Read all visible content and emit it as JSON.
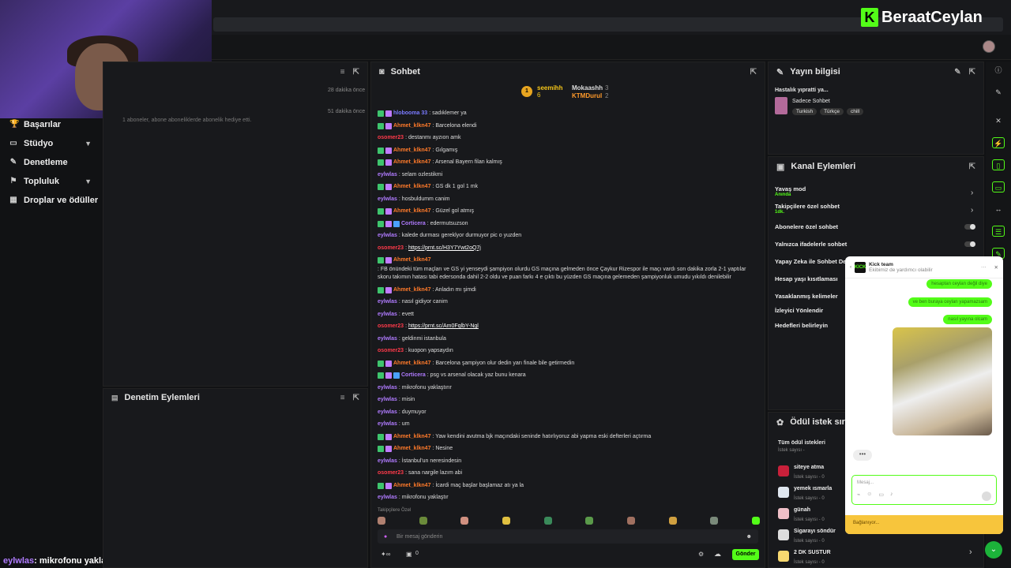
{
  "brand": {
    "logo_letter": "K",
    "name": "BeraatCeylan",
    "accent": "#53fc18"
  },
  "nav": {
    "items": [
      {
        "label": "Başarılar",
        "icon": "trophy-icon",
        "chev": ""
      },
      {
        "label": "Stüdyo",
        "icon": "monitor-icon",
        "chev": "⌄"
      },
      {
        "label": "Denetleme",
        "icon": "wrench-icon",
        "chev": ""
      },
      {
        "label": "Topluluk",
        "icon": "community-icon",
        "chev": "⌄"
      },
      {
        "label": "Droplar ve ödüller",
        "icon": "gift-icon",
        "chev": ""
      }
    ]
  },
  "caption": {
    "user": "eylwlas",
    "text": ": mikrofonu yaklaştır"
  },
  "notifications": {
    "rows": [
      {
        "time": "28 dakika önce"
      },
      {
        "time": "51 dakika önce",
        "text": "1 aboneler, abone aboneliklerde abonelik hediye etti."
      }
    ]
  },
  "moderation": {
    "title": "Denetim Eylemleri"
  },
  "chat": {
    "title": "Sohbet",
    "leaders": [
      {
        "name": "seemihh",
        "count": "6"
      },
      {
        "name": "Mokaashh",
        "count": "3"
      },
      {
        "name": "KTMDurul",
        "count": "2"
      }
    ],
    "messages": [
      {
        "user": "hlobooma 33",
        "color": "#7a7aff",
        "text": ": sadıklemer ya",
        "badges": 2
      },
      {
        "user": "Ahmet_klkn47",
        "color": "#ff7a2a",
        "text": ": Barcelona elendi",
        "badges": 2
      },
      {
        "user": "osomer23",
        "color": "#ff3a4a",
        "text": ": destanmı ayzıon amk",
        "badges": 0
      },
      {
        "user": "Ahmet_klkn47",
        "color": "#ff7a2a",
        "text": ": Gılgamış",
        "badges": 2
      },
      {
        "user": "Ahmet_klkn47",
        "color": "#ff7a2a",
        "text": ": Arsenal Bayern filan kalmış",
        "badges": 2
      },
      {
        "user": "eylwlas",
        "color": "#b07bff",
        "text": ": selam ozlestikmi",
        "badges": 0
      },
      {
        "user": "Ahmet_klkn47",
        "color": "#ff7a2a",
        "text": ": GS dk 1 gol 1 mk",
        "badges": 2
      },
      {
        "user": "eylwlas",
        "color": "#b07bff",
        "text": ": hosbuldumm canim",
        "badges": 0
      },
      {
        "user": "Ahmet_klkn47",
        "color": "#ff7a2a",
        "text": ": Güzel gol atmış",
        "badges": 2
      },
      {
        "user": "Corticera",
        "color": "#b07bff",
        "text": ": edermutsuzson",
        "badges": 3
      },
      {
        "user": "eylwlas",
        "color": "#b07bff",
        "text": ": kalede durması gereklyor durmuyor pic o yuzden",
        "badges": 0
      },
      {
        "user": "osomer23",
        "color": "#ff3a4a",
        "text": ": ",
        "link": "https://prnt.sc/H3Y7Ywt2oQ7j",
        "badges": 0
      },
      {
        "user": "Ahmet_klkn47",
        "color": "#ff7a2a",
        "text": ": FB önündeki tüm maçları ve GS yi yenseydi şampiyon olurdu GS maçına gelmeden önce Çaykur Rizespor ile maçı vardı son dakika zorla 2-1 yaptılar skoru takımın hatası tabi edersonda dahil 2-2 oldu ve puan farkı 4 e çıktı bu yüzden GS maçına gelemeden şampiyonluk umudu yıkıldı denilebilir",
        "badges": 2
      },
      {
        "user": "Ahmet_klkn47",
        "color": "#ff7a2a",
        "text": ": Anladın mı şimdi",
        "badges": 2
      },
      {
        "user": "eylwlas",
        "color": "#b07bff",
        "text": ": nasıl gidiyor canim",
        "badges": 0
      },
      {
        "user": "eylwlas",
        "color": "#b07bff",
        "text": ": evett",
        "badges": 0
      },
      {
        "user": "osomer23",
        "color": "#ff3a4a",
        "text": ": ",
        "link": "https://prnt.sc/Am0FqlbY-Ngl",
        "badges": 0
      },
      {
        "user": "eylwlas",
        "color": "#b07bff",
        "text": ": geldinmi istanbula",
        "badges": 0
      },
      {
        "user": "osomer23",
        "color": "#ff3a4a",
        "text": ": kuopon yapsaydın",
        "badges": 0
      },
      {
        "user": "Ahmet_klkn47",
        "color": "#ff7a2a",
        "text": ": Barcelona şampiyon olur dedin yarı finale bile getirmedin",
        "badges": 2
      },
      {
        "user": "Corticera",
        "color": "#b07bff",
        "text": ": psg vs arsenal olacak yaz bunu kenara",
        "badges": 3
      },
      {
        "user": "eylwlas",
        "color": "#b07bff",
        "text": ": mikrofonu yaklaştırır",
        "badges": 0
      },
      {
        "user": "eylwlas",
        "color": "#b07bff",
        "text": ": misin",
        "badges": 0
      },
      {
        "user": "eylwlas",
        "color": "#b07bff",
        "text": ": duymuyor",
        "badges": 0
      },
      {
        "user": "eylwlas",
        "color": "#b07bff",
        "text": ": um",
        "badges": 0
      },
      {
        "user": "Ahmet_klkn47",
        "color": "#ff7a2a",
        "text": ": Yaw kendini avutma bjk maçındaki seninde hatırlıyoruz abi yapma eski defterleri açtırma",
        "badges": 2
      },
      {
        "user": "Ahmet_klkn47",
        "color": "#ff7a2a",
        "text": ": Nesine",
        "badges": 2
      },
      {
        "user": "eylwlas",
        "color": "#b07bff",
        "text": ": İstanbul'un neresindesin",
        "badges": 0
      },
      {
        "user": "osomer23",
        "color": "#ff3a4a",
        "text": ": sana nargile lazım abi",
        "badges": 0
      },
      {
        "user": "Ahmet_klkn47",
        "color": "#ff7a2a",
        "text": ": İcardi maç başlar başlamaz atı ya la",
        "badges": 2
      },
      {
        "user": "eylwlas",
        "color": "#b07bff",
        "text": ": mikrofonu yaklaştır",
        "badges": 0
      }
    ],
    "followers_only": "Takipçilere Özel",
    "input_placeholder": "Bir mesaj gönderin",
    "counter": "0",
    "send_label": "Gönder"
  },
  "info": {
    "title": "Yayın bilgisi",
    "stream_title": "Hastalık yıpratti ya...",
    "category": "Sadece Sohbet",
    "tags": [
      "Turkish",
      "Türkçe",
      "chill"
    ]
  },
  "actions": {
    "title": "Kanal Eylemleri",
    "items": [
      {
        "label": "Yavaş mod",
        "sub": "Anında"
      },
      {
        "label": "Takipçilere özel sohbet",
        "sub": "1dk."
      },
      {
        "label": "Abonelere özel sohbet",
        "sub": ""
      },
      {
        "label": "Yalnızca ifadelerle sohbet",
        "sub": ""
      },
      {
        "label": "Yapay Zeka ile Sohbet Dene",
        "sub": ""
      },
      {
        "label": "Hesap yaşı kısıtlaması",
        "sub": ""
      },
      {
        "label": "Yasaklanmış kelimeler",
        "sub": ""
      },
      {
        "label": "İzleyici Yönlendir",
        "sub": ""
      },
      {
        "label": "Hedefleri belirleyin",
        "sub": ""
      }
    ]
  },
  "rewards": {
    "title": "Ödül istek sırası",
    "all_label": "Tüm ödül istekleri",
    "all_sub": "İstek sayısı -",
    "items": [
      {
        "label": "siteye atma",
        "sub": "İstek sayısı - 0",
        "color": "#c8203a"
      },
      {
        "label": "yemek ısmarla",
        "sub": "İstek sayısı - 0",
        "color": "#dfe6ef"
      },
      {
        "label": "günah",
        "sub": "İstek sayısı - 0",
        "color": "#f0c0c8"
      },
      {
        "label": "Sigarayı söndür",
        "sub": "İstek sayısı - 0",
        "color": "#ddd"
      },
      {
        "label": "2 DK SUSTUR",
        "sub": "İstek sayısı - 0",
        "color": "#f7d870"
      }
    ]
  },
  "kick_chat": {
    "logo": "KICK",
    "team": "Kick team",
    "subtitle": "Ekibimiz de yardımcı olabilir",
    "bubbles": [
      "hesaptan ceylan değil diye",
      "ve ben buraya ceylan yapamazsam",
      "nasıl yayına olcam"
    ],
    "dots": "•••",
    "input_placeholder": "Mesaj...",
    "footer": "Bağlanıyor..."
  }
}
